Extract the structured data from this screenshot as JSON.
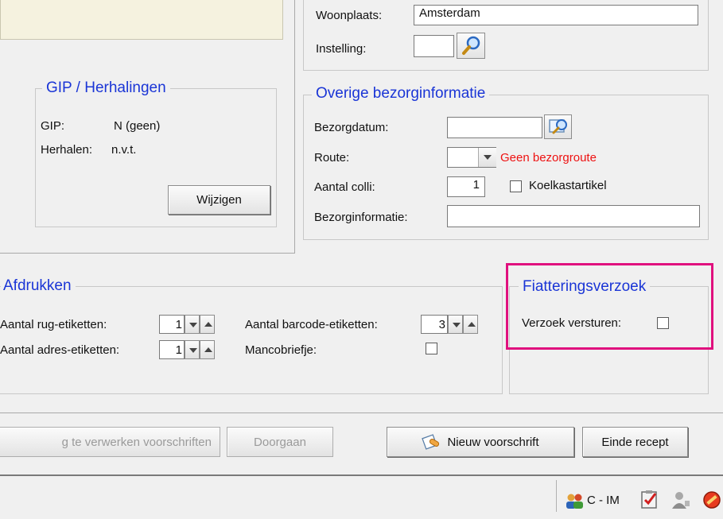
{
  "colors": {
    "title_blue": "#1a35d6",
    "warning_red": "#ee1111",
    "highlight_magenta": "#e0107e",
    "panel_cream": "#f5f2df"
  },
  "address": {
    "woonplaats_label": "Woonplaats:",
    "woonplaats_value": "Amsterdam",
    "instelling_label": "Instelling:",
    "instelling_value": ""
  },
  "gip": {
    "title": "GIP / Herhalingen",
    "gip_label": "GIP:",
    "gip_value": "N (geen)",
    "herhalen_label": "Herhalen:",
    "herhalen_value": "n.v.t.",
    "wijzigen_button": "Wijzigen"
  },
  "bezorg": {
    "title": "Overige bezorginformatie",
    "datum_label": "Bezorgdatum:",
    "datum_value": "",
    "route_label": "Route:",
    "route_value": "",
    "route_warning": "Geen bezorgroute",
    "colli_label": "Aantal colli:",
    "colli_value": "1",
    "koelkast_label": "Koelkastartikel",
    "koelkast_checked": false,
    "info_label": "Bezorginformatie:",
    "info_value": ""
  },
  "afdrukken": {
    "title": "Afdrukken",
    "rug_label": "Aantal rug-etiketten:",
    "rug_value": "1",
    "adres_label": "Aantal adres-etiketten:",
    "adres_value": "1",
    "barcode_label": "Aantal barcode-etiketten:",
    "barcode_value": "3",
    "manco_label": "Mancobriefje:",
    "manco_checked": false
  },
  "fiat": {
    "title": "Fiatteringsverzoek",
    "versturen_label": "Verzoek versturen:",
    "versturen_checked": false
  },
  "actions": {
    "te_verwerken": "g te verwerken voorschriften",
    "doorgaan": "Doorgaan",
    "nieuw_voorschrift": "Nieuw voorschrift",
    "einde_recept": "Einde recept"
  },
  "statusbar": {
    "user_code": "C - IM",
    "icons": [
      "users-icon",
      "clipboard-icon",
      "user-icon",
      "alert-icon"
    ]
  }
}
